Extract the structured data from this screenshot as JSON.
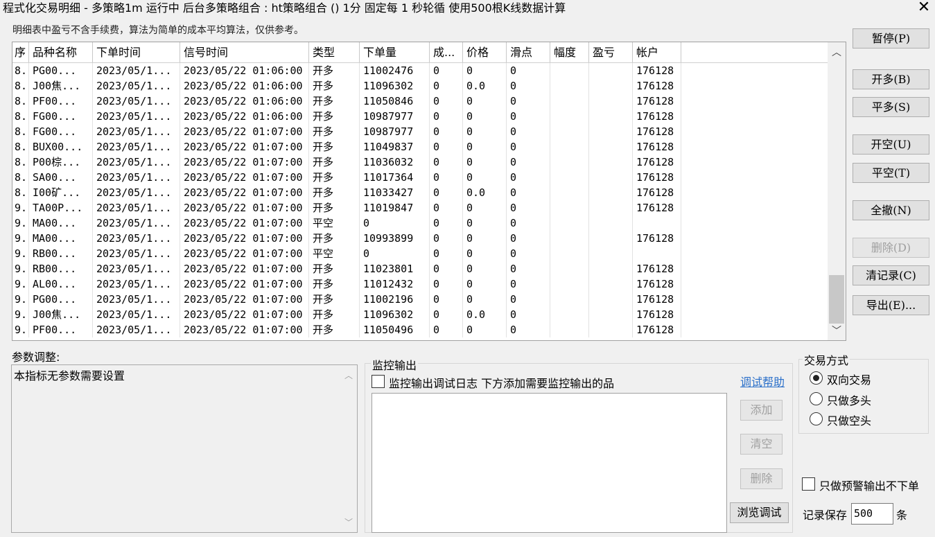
{
  "window": {
    "title": "程式化交易明细 - 多策略1m 运行中  后台多策略组合 : ht策略组合 () 1分 固定每 1 秒轮循 使用500根K线数据计算",
    "close_glyph": "✕"
  },
  "note": "明细表中盈亏不含手续费，算法为简单的成本平均算法，仅供参考。",
  "table": {
    "columns": [
      "序",
      "品种名称",
      "下单时间",
      "信号时间",
      "类型",
      "下单量",
      "成...",
      "价格",
      "滑点",
      "幅度",
      "盈亏",
      "帐户"
    ],
    "rows": [
      [
        "8.",
        "PG00...",
        "2023/05/1...",
        "2023/05/22 01:06:00",
        "开多",
        "11002476",
        "0",
        "0",
        "0",
        "",
        "",
        "176128"
      ],
      [
        "8.",
        "J00焦...",
        "2023/05/1...",
        "2023/05/22 01:06:00",
        "开多",
        "11096302",
        "0",
        "0.0",
        "0",
        "",
        "",
        "176128"
      ],
      [
        "8.",
        "PF00...",
        "2023/05/1...",
        "2023/05/22 01:06:00",
        "开多",
        "11050846",
        "0",
        "0",
        "0",
        "",
        "",
        "176128"
      ],
      [
        "8.",
        "FG00...",
        "2023/05/1...",
        "2023/05/22 01:06:00",
        "开多",
        "10987977",
        "0",
        "0",
        "0",
        "",
        "",
        "176128"
      ],
      [
        "8.",
        "FG00...",
        "2023/05/1...",
        "2023/05/22 01:07:00",
        "开多",
        "10987977",
        "0",
        "0",
        "0",
        "",
        "",
        "176128"
      ],
      [
        "8.",
        "BUX00...",
        "2023/05/1...",
        "2023/05/22 01:07:00",
        "开多",
        "11049837",
        "0",
        "0",
        "0",
        "",
        "",
        "176128"
      ],
      [
        "8.",
        "P00棕...",
        "2023/05/1...",
        "2023/05/22 01:07:00",
        "开多",
        "11036032",
        "0",
        "0",
        "0",
        "",
        "",
        "176128"
      ],
      [
        "8.",
        "SA00...",
        "2023/05/1...",
        "2023/05/22 01:07:00",
        "开多",
        "11017364",
        "0",
        "0",
        "0",
        "",
        "",
        "176128"
      ],
      [
        "8.",
        "I00矿...",
        "2023/05/1...",
        "2023/05/22 01:07:00",
        "开多",
        "11033427",
        "0",
        "0.0",
        "0",
        "",
        "",
        "176128"
      ],
      [
        "9.",
        "TA00P...",
        "2023/05/1...",
        "2023/05/22 01:07:00",
        "开多",
        "11019847",
        "0",
        "0",
        "0",
        "",
        "",
        "176128"
      ],
      [
        "9.",
        "MA00...",
        "2023/05/1...",
        "2023/05/22 01:07:00",
        "平空",
        "0",
        "0",
        "0",
        "0",
        "",
        "",
        ""
      ],
      [
        "9.",
        "MA00...",
        "2023/05/1...",
        "2023/05/22 01:07:00",
        "开多",
        "10993899",
        "0",
        "0",
        "0",
        "",
        "",
        "176128"
      ],
      [
        "9.",
        "RB00...",
        "2023/05/1...",
        "2023/05/22 01:07:00",
        "平空",
        "0",
        "0",
        "0",
        "0",
        "",
        "",
        ""
      ],
      [
        "9.",
        "RB00...",
        "2023/05/1...",
        "2023/05/22 01:07:00",
        "开多",
        "11023801",
        "0",
        "0",
        "0",
        "",
        "",
        "176128"
      ],
      [
        "9.",
        "AL00...",
        "2023/05/1...",
        "2023/05/22 01:07:00",
        "开多",
        "11012432",
        "0",
        "0",
        "0",
        "",
        "",
        "176128"
      ],
      [
        "9.",
        "PG00...",
        "2023/05/1...",
        "2023/05/22 01:07:00",
        "开多",
        "11002196",
        "0",
        "0",
        "0",
        "",
        "",
        "176128"
      ],
      [
        "9.",
        "J00焦...",
        "2023/05/1...",
        "2023/05/22 01:07:00",
        "开多",
        "11096302",
        "0",
        "0.0",
        "0",
        "",
        "",
        "176128"
      ],
      [
        "9.",
        "PF00...",
        "2023/05/1...",
        "2023/05/22 01:07:00",
        "开多",
        "11050496",
        "0",
        "0",
        "0",
        "",
        "",
        "176128"
      ]
    ],
    "scroll_up": "︿",
    "scroll_down": "﹀"
  },
  "buttons": {
    "pause": "暂停(P)",
    "open_long": "开多(B)",
    "close_long": "平多(S)",
    "open_short": "开空(U)",
    "close_short": "平空(T)",
    "cancel_all": "全撤(N)",
    "delete": "删除(D)",
    "clear_records": "清记录(C)",
    "export": "导出(E)..."
  },
  "params": {
    "label": "参数调整:",
    "text": "本指标无参数需要设置",
    "scroll_up": "︿",
    "scroll_down": "﹀"
  },
  "monitor": {
    "title": "监控输出",
    "checkbox_label": "监控输出调试日志 下方添加需要监控输出的品",
    "checkbox_checked": false,
    "help_link": "调试帮助",
    "add": "添加",
    "clear": "清空",
    "delete": "删除",
    "browse": "浏览调试"
  },
  "trade_mode": {
    "title": "交易方式",
    "options": [
      "双向交易",
      "只做多头",
      "只做空头"
    ],
    "selected": "双向交易"
  },
  "warn_only": {
    "label": "只做预警输出不下单",
    "checked": false
  },
  "record_keep": {
    "label": "记录保存",
    "value": "500",
    "unit": "条"
  }
}
